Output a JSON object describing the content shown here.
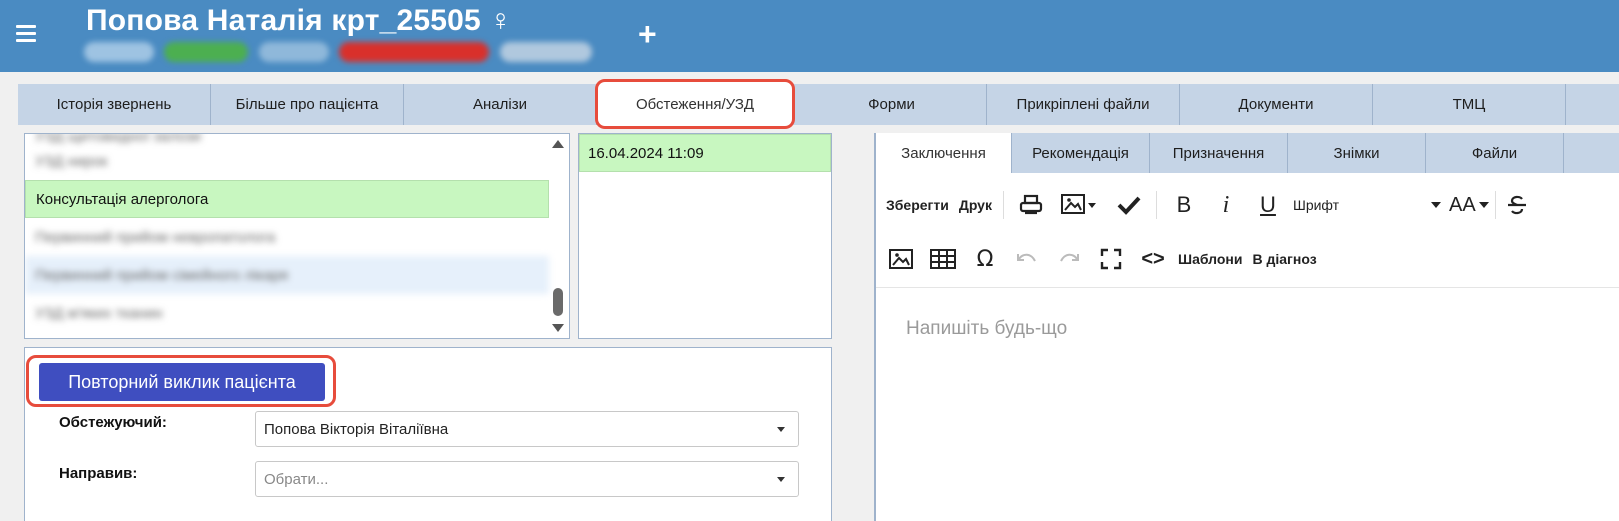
{
  "header": {
    "patient_name": "Попова Наталія крт_25505 ♀",
    "add_label": "+"
  },
  "tabs": [
    {
      "label": "Історія звернень"
    },
    {
      "label": "Більше про пацієнта"
    },
    {
      "label": "Аналізи"
    },
    {
      "label": "Обстеження/УЗД"
    },
    {
      "label": "Форми"
    },
    {
      "label": "Прикріплені файли"
    },
    {
      "label": "Документи"
    },
    {
      "label": "ТМЦ"
    }
  ],
  "active_tab": "Обстеження/УЗД",
  "exam_list": {
    "items": [
      {
        "label": "УЗД щитовидної залози"
      },
      {
        "label": "УЗД нирок"
      },
      {
        "label": "Консультація алерголога"
      },
      {
        "label": "Первинний прийом невропатолога"
      },
      {
        "label": "Первинний прийом сімейного лікаря"
      },
      {
        "label": "УЗД м'яких тканин"
      }
    ],
    "selected": "Консультація алерголога"
  },
  "dates": {
    "items": [
      "16.04.2024 11:09"
    ]
  },
  "form": {
    "recall_button": "Повторний виклик пацієнта",
    "examiner_label": "Обстежуючий:",
    "examiner_value": "Попова Вікторія Віталіївна",
    "referrer_label": "Направив:",
    "referrer_placeholder": "Обрати..."
  },
  "editor": {
    "subtabs": [
      {
        "label": "Заключення"
      },
      {
        "label": "Рекомендація"
      },
      {
        "label": "Призначення"
      },
      {
        "label": "Знімки"
      },
      {
        "label": "Файли"
      }
    ],
    "active_subtab": "Заключення",
    "toolbar": {
      "save_label": "Зберегти",
      "print_label": "Друк",
      "bold": "B",
      "italic": "i",
      "underline": "U",
      "font_label": "Шрифт",
      "font_size_label": "AA",
      "special_char": "Ω",
      "code": "<>",
      "templates_label": "Шаблони",
      "to_diagnosis_label": "В діагноз"
    },
    "placeholder": "Напишіть будь-що"
  },
  "colors": {
    "header_bg": "#4a8bc2",
    "tab_bg": "#c5d4e6",
    "selected_row": "#c8f7c0",
    "primary_button": "#3f4ec0",
    "highlight_outline": "#e74c3c"
  }
}
